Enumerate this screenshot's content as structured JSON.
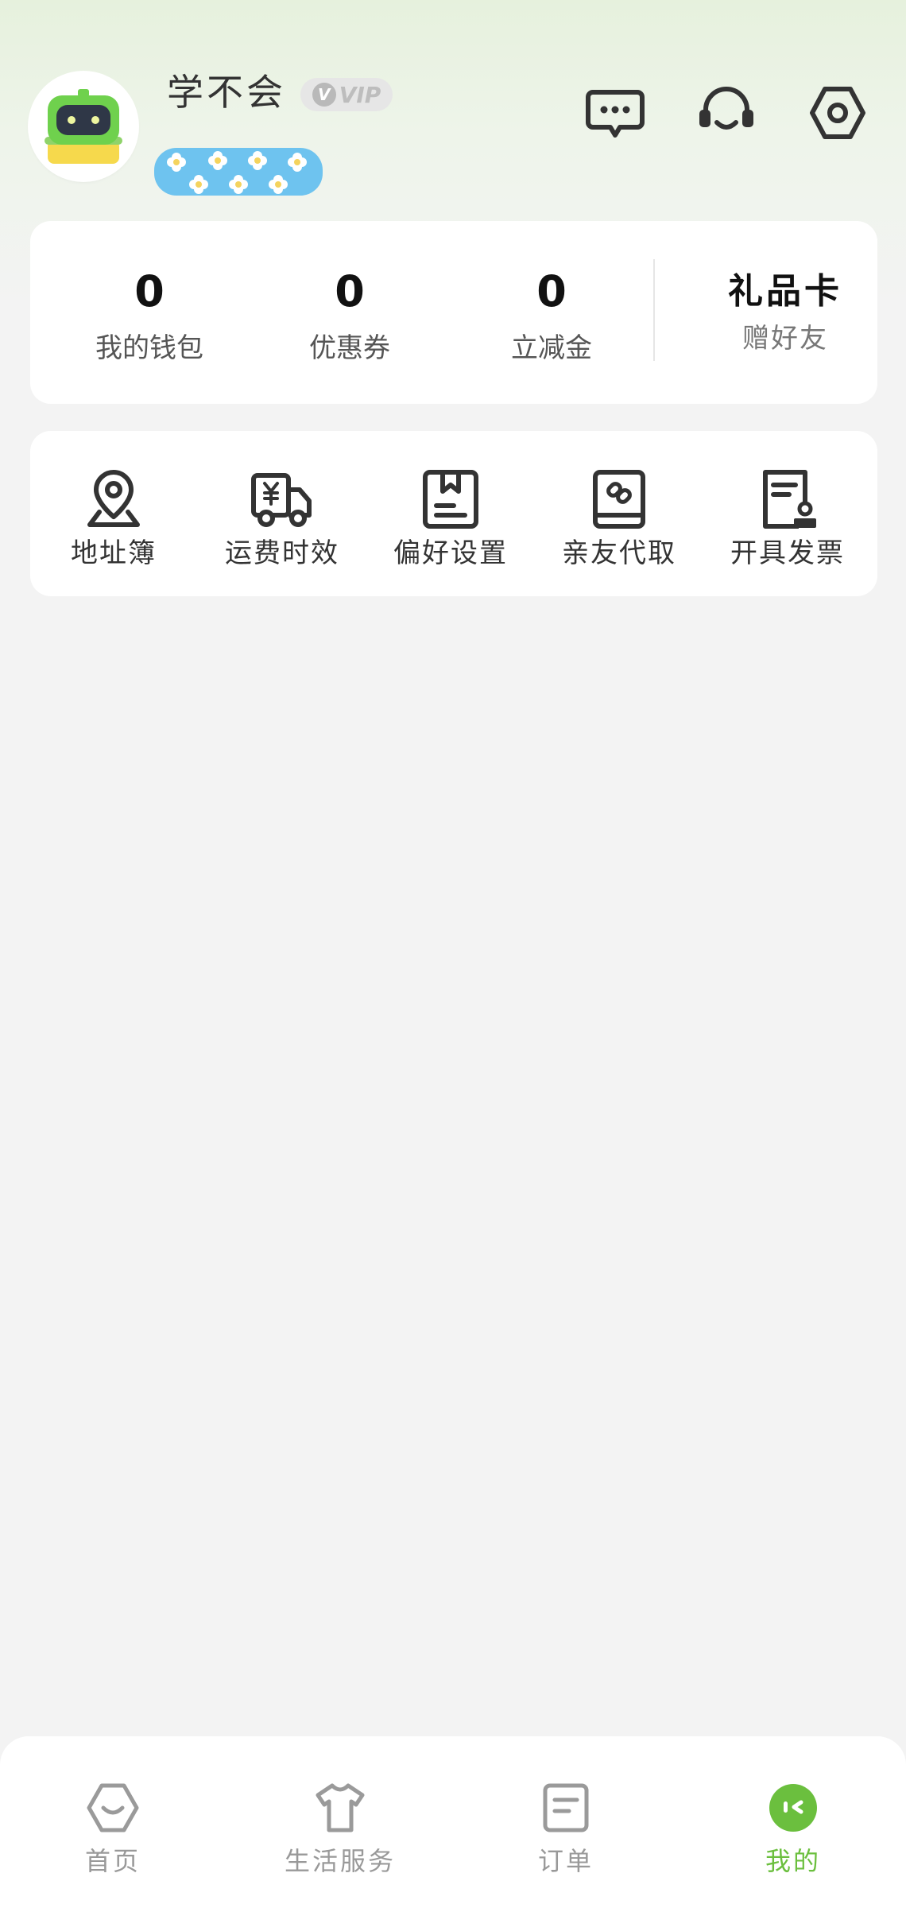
{
  "user": {
    "name": "学不会",
    "vip_text": "VIP",
    "vip_icon_letter": "V"
  },
  "header_icons": {
    "message": "message-icon",
    "service": "headset-icon",
    "settings": "settings-icon"
  },
  "stats": [
    {
      "value": "0",
      "label": "我的钱包"
    },
    {
      "value": "0",
      "label": "优惠券"
    },
    {
      "value": "0",
      "label": "立减金"
    }
  ],
  "gift_card": {
    "title": "礼品卡",
    "subtitle": "赠好友"
  },
  "tools": [
    {
      "label": "地址簿",
      "icon": "location-pin-icon"
    },
    {
      "label": "运费时效",
      "icon": "delivery-truck-icon"
    },
    {
      "label": "偏好设置",
      "icon": "box-icon"
    },
    {
      "label": "亲友代取",
      "icon": "link-book-icon"
    },
    {
      "label": "开具发票",
      "icon": "invoice-icon"
    }
  ],
  "nav": [
    {
      "label": "首页",
      "icon": "home-icon",
      "active": false
    },
    {
      "label": "生活服务",
      "icon": "shirt-icon",
      "active": false
    },
    {
      "label": "订单",
      "icon": "order-icon",
      "active": false
    },
    {
      "label": "我的",
      "icon": "profile-icon",
      "active": true
    }
  ],
  "colors": {
    "accent": "#6bbf3e",
    "vip_badge_bg": "#e6e6e6",
    "flower_strip": "#6ec3ef",
    "card_bg": "#ffffff",
    "page_bg": "#f3f3f3"
  }
}
